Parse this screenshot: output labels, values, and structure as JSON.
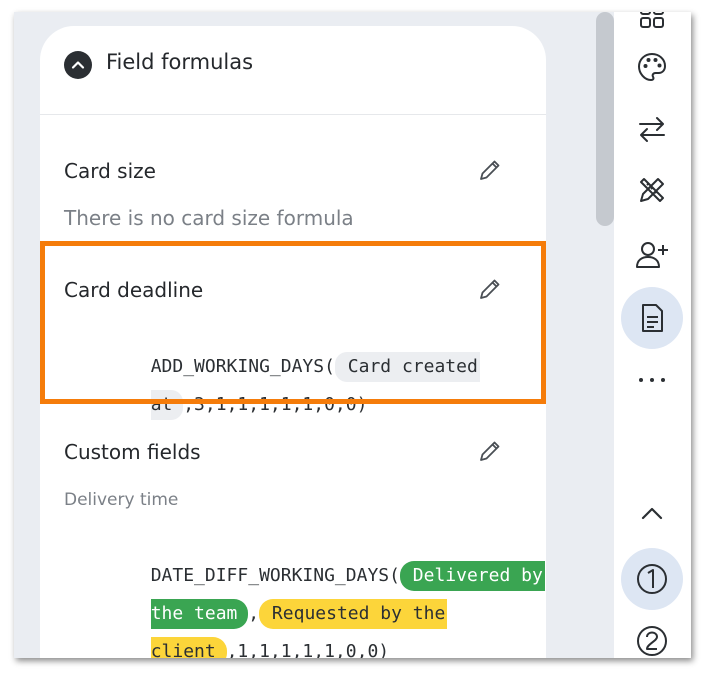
{
  "panel": {
    "title": "Field formulas",
    "collapse_icon": "chevron-up-icon"
  },
  "card_size": {
    "title": "Card size",
    "empty_text": "There is no card size formula"
  },
  "card_deadline": {
    "title": "Card deadline",
    "formula": {
      "func": "ADD_WORKING_DAYS(",
      "chip_part1": " Card created",
      "chip_part2": "at ",
      "args": ",3,1,1,1,1,1,0,0)"
    }
  },
  "custom_fields": {
    "title": "Custom fields",
    "field_name": "Delivery time",
    "formula": {
      "func": "DATE_DIFF_WORKING_DAYS(",
      "chip1_part1": " Delivered by",
      "chip1_part2": "the team ",
      "separator": ",",
      "chip2_part1": " Requested by the",
      "chip2_part2": "client ",
      "args": ",1,1,1,1,1,0,0)"
    }
  },
  "rail": {
    "icons": [
      "grid-icon",
      "palette-icon",
      "swap-arrows-icon",
      "design-tools-icon",
      "add-user-icon",
      "document-icon",
      "more-icon",
      "chevron-up-icon",
      "circled-1-icon",
      "circled-2-icon"
    ]
  },
  "colors": {
    "highlight": "#f57c0a",
    "chip_green": "#3aa552",
    "chip_yellow": "#fcd53a",
    "chip_gray": "#eceef1"
  }
}
